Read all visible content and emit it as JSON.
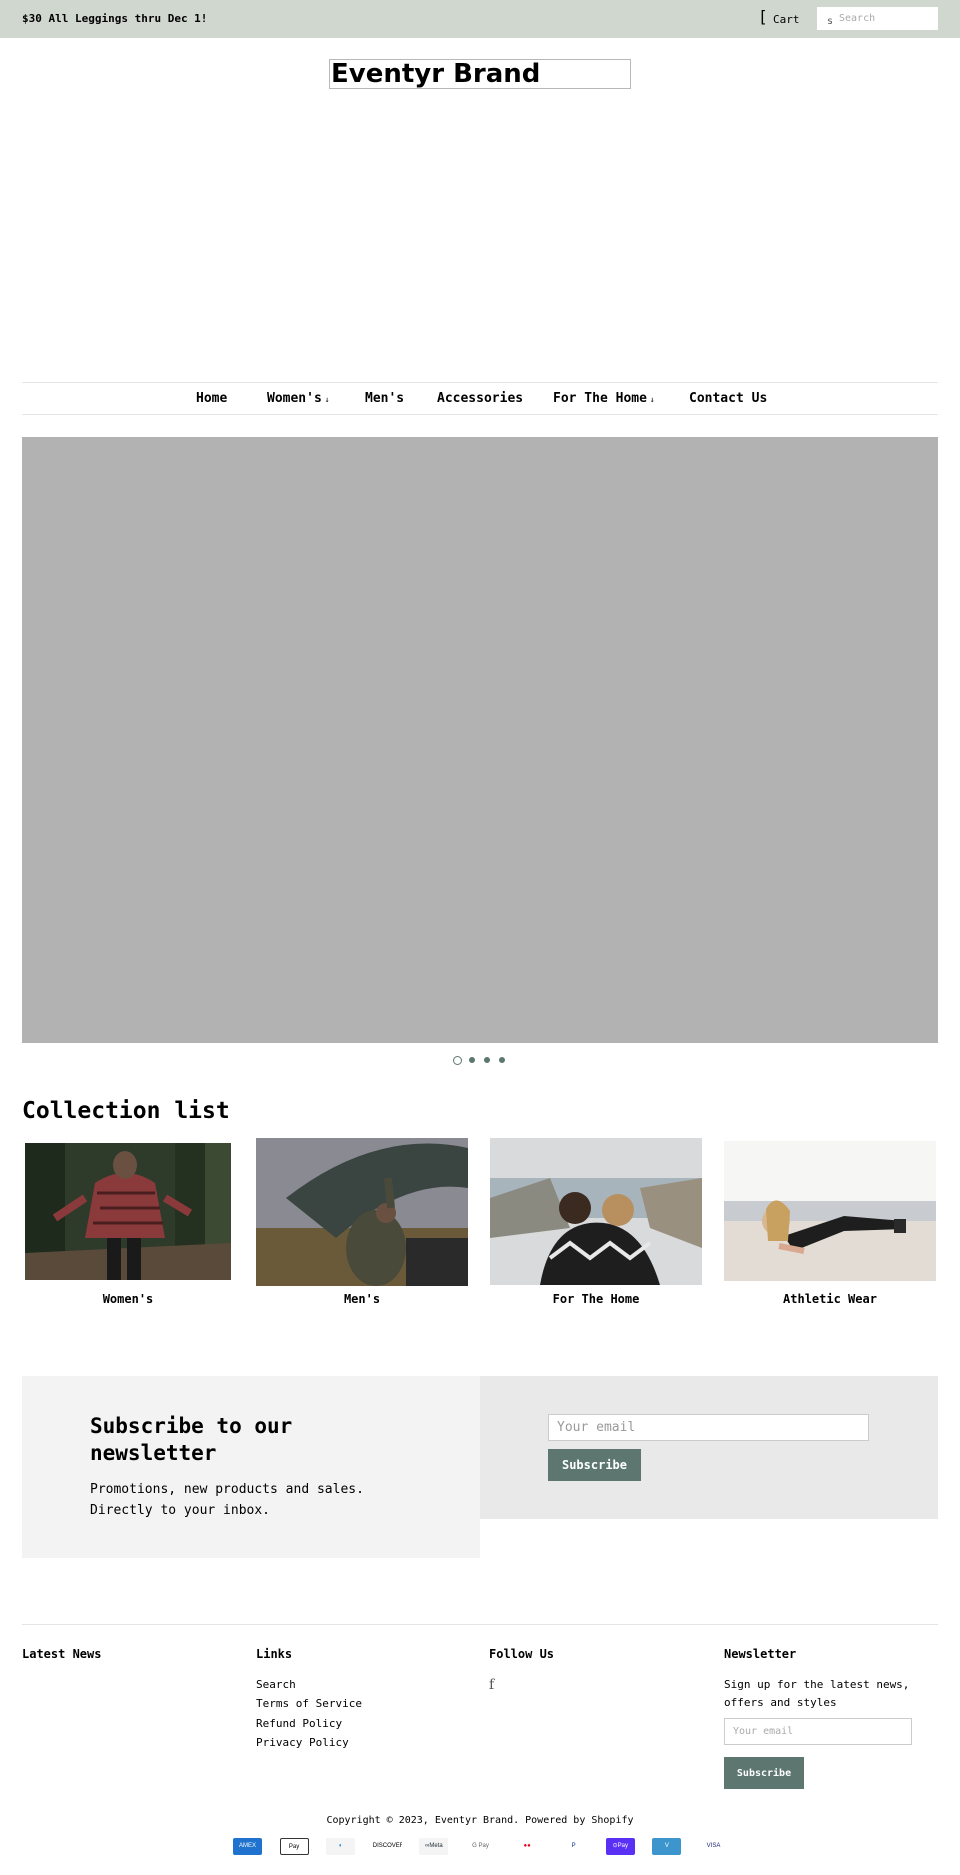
{
  "announcement": "$30 All Leggings thru Dec 1!",
  "header": {
    "cart_label": "Cart",
    "cart_icon": "bracket-cart-icon",
    "search_placeholder": "Search",
    "search_icon_glyph": "s",
    "logo_text": "Eventyr Brand"
  },
  "nav": {
    "items": [
      {
        "label": "Home",
        "has_dropdown": false
      },
      {
        "label": "Women's",
        "has_dropdown": true
      },
      {
        "label": "Men's",
        "has_dropdown": false
      },
      {
        "label": "Accessories",
        "has_dropdown": false
      },
      {
        "label": "For The Home",
        "has_dropdown": true
      },
      {
        "label": "Contact Us",
        "has_dropdown": false
      }
    ],
    "dropdown_glyph": "↓"
  },
  "slideshow": {
    "slide_count": 4,
    "active_slide": 1
  },
  "collections": {
    "title": "Collection list",
    "items": [
      {
        "name": "Women's",
        "image": "woman in flannel shirt in forest"
      },
      {
        "name": "Men's",
        "image": "man setting up tent"
      },
      {
        "name": "For The Home",
        "image": "couple wrapped in blanket by cliffs"
      },
      {
        "name": "Athletic Wear",
        "image": "woman doing plank on beach"
      }
    ]
  },
  "newsletter": {
    "title": "Subscribe to our newsletter",
    "text": "Promotions, new products and sales. Directly to your inbox.",
    "email_placeholder": "Your email",
    "button": "Subscribe"
  },
  "footer": {
    "latest_news_heading": "Latest News",
    "links_heading": "Links",
    "links": [
      "Search",
      "Terms of Service",
      "Refund Policy",
      "Privacy Policy"
    ],
    "follow_heading": "Follow Us",
    "follow_icon": "facebook-icon",
    "follow_glyph": "f",
    "newsletter_heading": "Newsletter",
    "newsletter_text": "Sign up for the latest news, offers and styles",
    "email_placeholder": "Your email",
    "button": "Subscribe",
    "copyright": "Copyright © 2023, Eventyr Brand. Powered by Shopify"
  },
  "payment_methods": [
    {
      "name": "American Express",
      "label": "AMEX",
      "bg": "#1f72cd",
      "fg": "#ffffff",
      "border": false
    },
    {
      "name": "Apple Pay",
      "label": " Pay",
      "bg": "#ffffff",
      "fg": "#000000",
      "border": true
    },
    {
      "name": "Diners Club",
      "label": "◐",
      "bg": "#f4f4f4",
      "fg": "#0079be",
      "border": false
    },
    {
      "name": "Discover",
      "label": "DISCOVER",
      "bg": "#ffffff",
      "fg": "#000000",
      "border": false
    },
    {
      "name": "Meta Pay",
      "label": "∞Meta",
      "bg": "#f4f4f4",
      "fg": "#1c2b33",
      "border": false
    },
    {
      "name": "Google Pay",
      "label": "G Pay",
      "bg": "#ffffff",
      "fg": "#5f6368",
      "border": false
    },
    {
      "name": "Mastercard",
      "label": "●●",
      "bg": "#ffffff",
      "fg": "#eb001b",
      "border": false
    },
    {
      "name": "PayPal",
      "label": "P",
      "bg": "#ffffff",
      "fg": "#003087",
      "border": false
    },
    {
      "name": "Shop Pay",
      "label": "⊙Pay",
      "bg": "#5a31f4",
      "fg": "#ffffff",
      "border": false
    },
    {
      "name": "Venmo",
      "label": "V",
      "bg": "#3d95ce",
      "fg": "#ffffff",
      "border": false
    },
    {
      "name": "Visa",
      "label": "VISA",
      "bg": "#ffffff",
      "fg": "#1a1f71",
      "border": false
    }
  ],
  "colors": {
    "announcement_bg": "#d0d7cf",
    "accent": "#5d7770",
    "hero_placeholder": "#b2b2b2"
  }
}
